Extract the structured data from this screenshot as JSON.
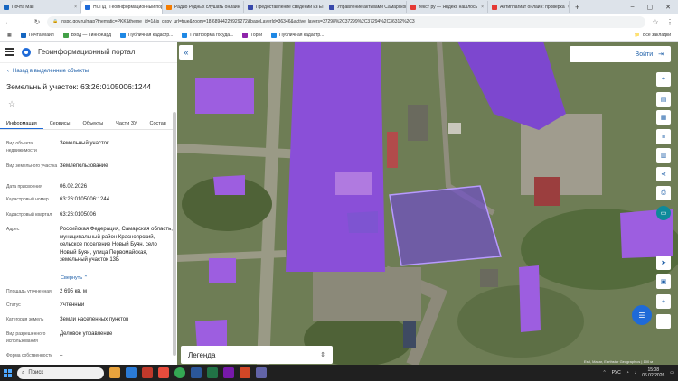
{
  "browser": {
    "tabs": [
      {
        "title": "Почта Mail",
        "color": "#1565c0"
      },
      {
        "title": "НСПД | Геоинформационный портал",
        "color": "#1e6ad8",
        "active": true
      },
      {
        "title": "Радио Родных слушать онлайн",
        "color": "#f57c00"
      },
      {
        "title": "Предоставление сведений из ЕГРН",
        "color": "#3949ab"
      },
      {
        "title": "Управление активами Самарской обл.",
        "color": "#3949ab"
      },
      {
        "title": "текст ру — Яндекс нашлось",
        "color": "#e53935"
      },
      {
        "title": "Антиплагиат онлайн: проверка",
        "color": "#e53935"
      }
    ],
    "new_tab": "+",
    "window_controls": [
      "–",
      "▢",
      "✕"
    ],
    "url": "nspd.gov.ru/map?thematic=PKK&theme_id=1&is_copy_url=true&zoom=18.68944229929272&baseLayerId=36346&active_layers=37298%2C37299%2C37294%2C36312%2C3",
    "bookmarks": [
      {
        "label": "Почта Майл",
        "color": "#1565c0"
      },
      {
        "label": "Вход — ТинноКард",
        "color": "#43a047"
      },
      {
        "label": "Публичная кадастр...",
        "color": "#1e88e5"
      },
      {
        "label": "Платформа госуда...",
        "color": "#1e88e5"
      },
      {
        "label": "Торги",
        "color": "#8e24aa"
      },
      {
        "label": "Публичная кадастр...",
        "color": "#1e88e5"
      }
    ],
    "all_bookmarks": "Все закладки"
  },
  "portal": {
    "title": "Геоинформационный портал",
    "back_link": "Назад в выделенные объекты",
    "object_title": "Земельный участок: 63:26:0105006:1244",
    "tabs": [
      "Информация",
      "Сервисы",
      "Объекты",
      "Части ЗУ",
      "Состав"
    ],
    "fields": [
      {
        "label": "Вид объекта недвижимости",
        "value": "Земельный участок"
      },
      {
        "label": "Вид земельного участка",
        "value": "Землепользование"
      },
      {
        "label": "Дата присвоения",
        "value": "06.02.2026"
      },
      {
        "label": "Кадастровый номер",
        "value": "63:26:0105006:1244"
      },
      {
        "label": "Кадастровый квартал",
        "value": "63:26:0105006"
      },
      {
        "label": "Адрес",
        "value": "Российская Федерация, Самарская область, муниципальный район Красноярский, сельское поселение Новый Буян, село Новый Буян, улица Первомайская, земельный участок 13Б"
      },
      {
        "label": "Площадь уточненная",
        "value": "2 695 кв. м"
      },
      {
        "label": "Статус",
        "value": "Учтенный"
      },
      {
        "label": "Категория земель",
        "value": "Земли населенных пунктов"
      },
      {
        "label": "Вид разрешенного использования",
        "value": "Деловое управление"
      },
      {
        "label": "Форма собственности",
        "value": "–"
      }
    ],
    "collapse_label": "Свернуть",
    "login_label": "Войти",
    "legend_label": "Легенда",
    "scale_text": "Esri, Maxar, Earthstar Geographics | 100 м"
  },
  "taskbar": {
    "search_placeholder": "Поиск",
    "lang": "РУС",
    "time": "15:08",
    "date": "06.02.2026"
  }
}
